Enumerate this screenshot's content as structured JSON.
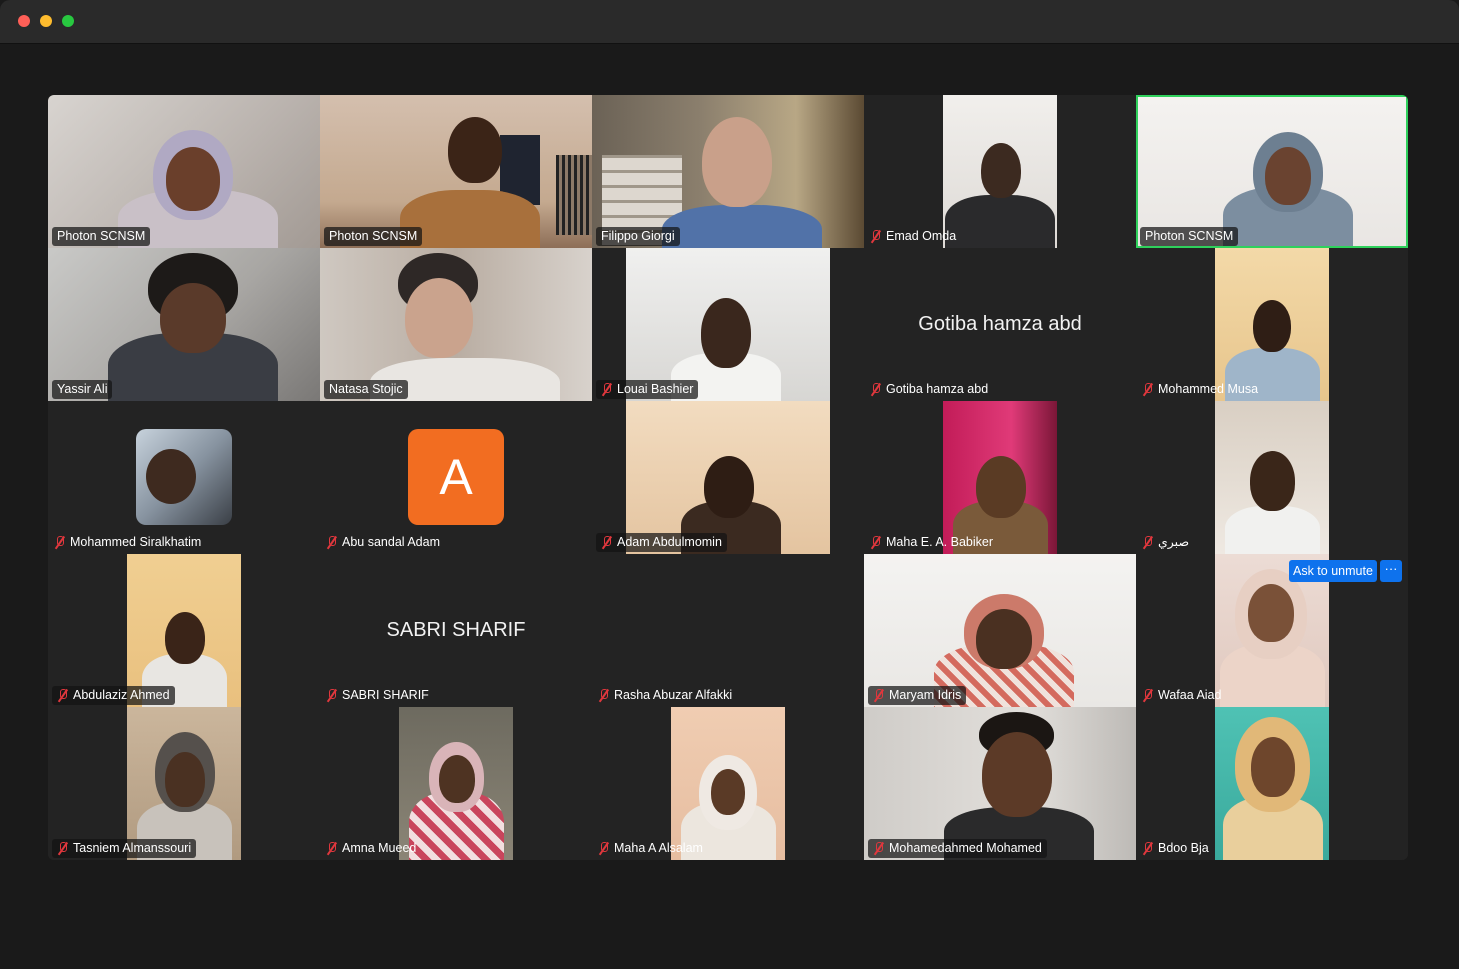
{
  "window": {
    "controls": [
      "close",
      "minimize",
      "maximize"
    ]
  },
  "participants": [
    {
      "name": "Photon SCNSM",
      "muted": false,
      "active": false
    },
    {
      "name": "Photon SCNSM",
      "muted": false,
      "active": false
    },
    {
      "name": "Filippo Giorgi",
      "muted": false,
      "active": false
    },
    {
      "name": "Emad Omda",
      "muted": true,
      "active": false
    },
    {
      "name": "Photon SCNSM",
      "muted": false,
      "active": true
    },
    {
      "name": "Yassir Ali",
      "muted": false,
      "active": false
    },
    {
      "name": "Natasa Stojic",
      "muted": false,
      "active": false
    },
    {
      "name": "Louai Bashier",
      "muted": true,
      "active": false
    },
    {
      "name": "Gotiba hamza abd",
      "muted": true,
      "active": false,
      "video_off_label": "Gotiba hamza abd"
    },
    {
      "name": "Mohammed Musa",
      "muted": true,
      "active": false
    },
    {
      "name": "Mohammed Siralkhatim",
      "muted": true,
      "active": false
    },
    {
      "name": "Abu sandal Adam",
      "muted": true,
      "active": false,
      "avatar_letter": "A"
    },
    {
      "name": "Adam Abdulmomin",
      "muted": true,
      "active": false
    },
    {
      "name": "Maha E. A. Babiker",
      "muted": true,
      "active": false
    },
    {
      "name": "صبري",
      "muted": true,
      "active": false
    },
    {
      "name": "Abdulaziz Ahmed",
      "muted": true,
      "active": false
    },
    {
      "name": "SABRI SHARIF",
      "muted": true,
      "active": false,
      "video_off_label": "SABRI SHARIF"
    },
    {
      "name": "Rasha Abuzar Alfakki",
      "muted": true,
      "active": false
    },
    {
      "name": "Maryam Idris",
      "muted": true,
      "active": false
    },
    {
      "name": "Wafaa Aiad",
      "muted": true,
      "active": false
    },
    {
      "name": "Tasniem Almanssouri",
      "muted": true,
      "active": false
    },
    {
      "name": "Amna Mueed",
      "muted": true,
      "active": false
    },
    {
      "name": "Maha A Alsalam",
      "muted": true,
      "active": false
    },
    {
      "name": "Mohamedahmed Mohamed",
      "muted": true,
      "active": false
    },
    {
      "name": "Bdoo Bja",
      "muted": true,
      "active": false
    }
  ],
  "overlay": {
    "ask_to_unmute": "Ask to unmute",
    "more": "···"
  },
  "colors": {
    "active_speaker_border": "#2fd15c",
    "mute_icon": "#e0373d",
    "button_blue": "#0e72ed",
    "avatar_orange": "#f26d21"
  }
}
